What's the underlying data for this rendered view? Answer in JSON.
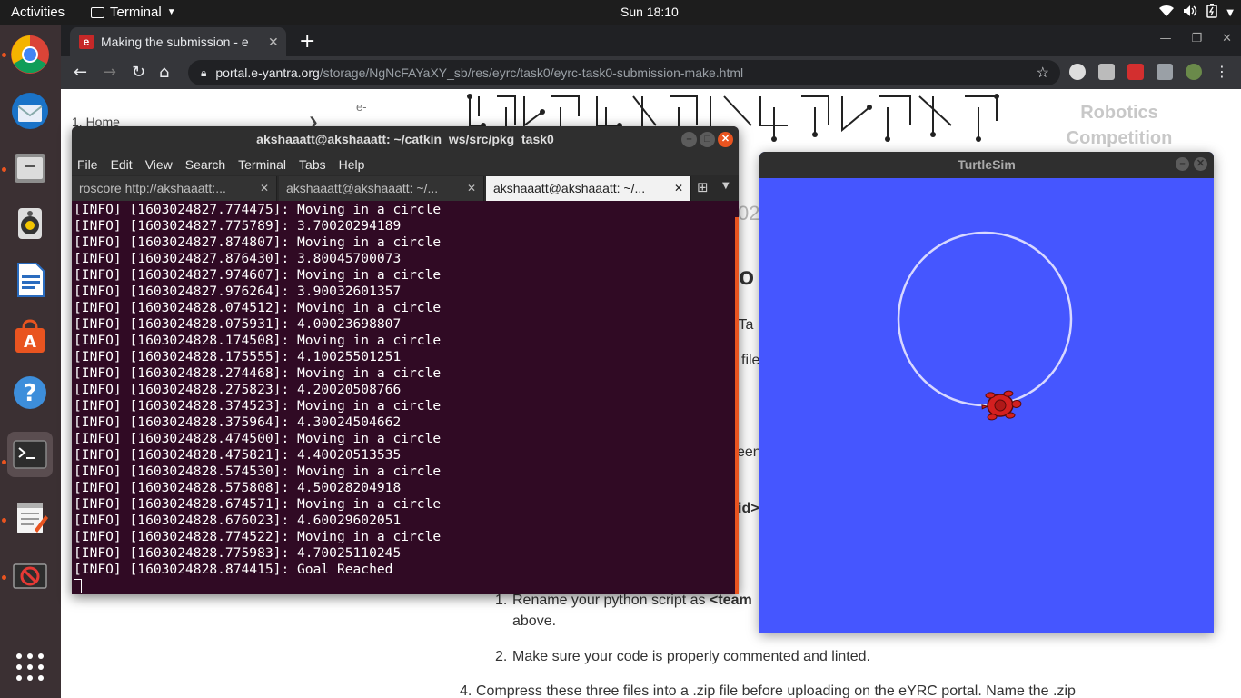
{
  "topbar": {
    "activities": "Activities",
    "app_name": "Terminal",
    "clock": "Sun 18:10"
  },
  "dock": {
    "items": [
      "chrome-icon",
      "thunderbird-icon",
      "files-icon",
      "rhythmbox-icon",
      "writer-icon",
      "software-icon",
      "help-icon",
      "terminal-icon",
      "gedit-icon",
      "blocked-app-icon",
      "show-apps-icon"
    ]
  },
  "browser": {
    "tab_title": "Making the submission - e",
    "favicon_letter": "e",
    "url_host": "portal.e-yantra.org",
    "url_path": "/storage/NgNcFAYaXY_sb/res/eyrc/task0/eyrc-task0-submission-make.html"
  },
  "page": {
    "sidebar_first_item": "1. Home",
    "sidebar_arrow": "❯",
    "robotics_line1": "Robotics",
    "robotics_line2": "Competition",
    "logo_alt": "e-",
    "frag_02": "02",
    "frag_o": "o",
    "frag_ta": "r Ta",
    "frag_file": "file",
    "frag_een": "een",
    "frag_id": "id>",
    "list_item1_text": "Rename your python script as ",
    "list_item1_bold": "<team",
    "list_item1_cont": "above.",
    "list_item2": "Make sure your code is properly commented and linted.",
    "list_item4": "Compress these three files into a .zip file before uploading on the eYRC portal. Name the .zip",
    "num1": "1.",
    "num2": "2.",
    "num4": "4."
  },
  "terminal": {
    "title": "akshaaatt@akshaaatt: ~/catkin_ws/src/pkg_task0",
    "menu": [
      "File",
      "Edit",
      "View",
      "Search",
      "Terminal",
      "Tabs",
      "Help"
    ],
    "tabs": [
      {
        "label": "roscore http://akshaaatt:..."
      },
      {
        "label": "akshaaatt@akshaaatt: ~/..."
      },
      {
        "label": "akshaaatt@akshaaatt: ~/..."
      }
    ],
    "lines": [
      "[INFO] [1603024827.774475]: Moving in a circle",
      "[INFO] [1603024827.775789]: 3.70020294189",
      "[INFO] [1603024827.874807]: Moving in a circle",
      "[INFO] [1603024827.876430]: 3.80045700073",
      "[INFO] [1603024827.974607]: Moving in a circle",
      "[INFO] [1603024827.976264]: 3.90032601357",
      "[INFO] [1603024828.074512]: Moving in a circle",
      "[INFO] [1603024828.075931]: 4.00023698807",
      "[INFO] [1603024828.174508]: Moving in a circle",
      "[INFO] [1603024828.175555]: 4.10025501251",
      "[INFO] [1603024828.274468]: Moving in a circle",
      "[INFO] [1603024828.275823]: 4.20020508766",
      "[INFO] [1603024828.374523]: Moving in a circle",
      "[INFO] [1603024828.375964]: 4.30024504662",
      "[INFO] [1603024828.474500]: Moving in a circle",
      "[INFO] [1603024828.475821]: 4.40020513535",
      "[INFO] [1603024828.574530]: Moving in a circle",
      "[INFO] [1603024828.575808]: 4.50028204918",
      "[INFO] [1603024828.674571]: Moving in a circle",
      "[INFO] [1603024828.676023]: 4.60029602051",
      "[INFO] [1603024828.774522]: Moving in a circle",
      "[INFO] [1603024828.775983]: 4.70025110245",
      "[INFO] [1603024828.874415]: Goal Reached"
    ]
  },
  "turtlesim": {
    "title": "TurtleSim",
    "background_color": "#4556ff",
    "trail_color": "#d8d8ff",
    "turtle_color": "#d42020"
  }
}
